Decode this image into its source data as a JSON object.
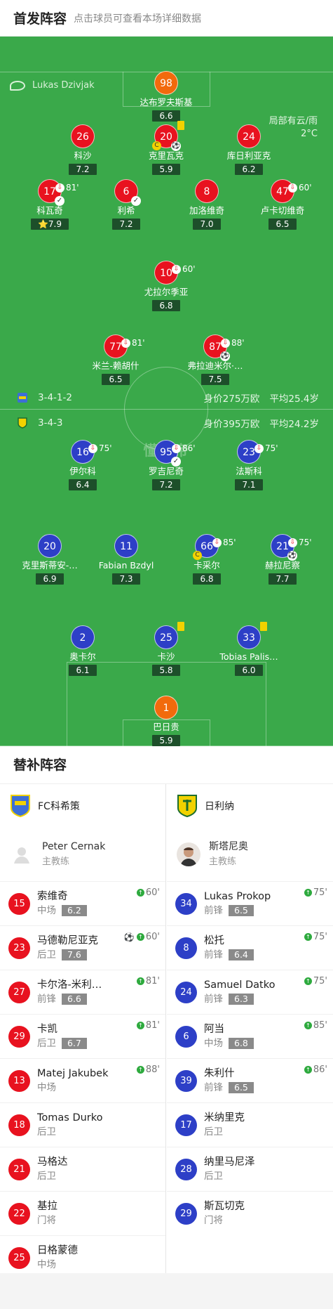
{
  "header": {
    "title": "首发阵容",
    "subtitle": "点击球员可查看本场详细数据"
  },
  "referee": "Lukas Dzivjak",
  "weather": {
    "condition": "局部有云/雨",
    "temp": "2°C"
  },
  "home_formation": {
    "formation": "3-4-1-2",
    "value": "身价275万欧",
    "age": "平均25.4岁"
  },
  "away_formation": {
    "formation": "3-4-3",
    "value": "身价395万欧",
    "age": "平均24.2岁"
  },
  "watermark": "懂球帝",
  "home_players": [
    {
      "num": "98",
      "name": "达布罗夫斯基",
      "rating": "6.6",
      "gk": true
    },
    {
      "num": "26",
      "name": "科沙",
      "rating": "7.2"
    },
    {
      "num": "20",
      "name": "克里瓦克",
      "rating": "5.9",
      "yellow": true,
      "captain": "C",
      "badge": "⚽"
    },
    {
      "num": "24",
      "name": "库日利亚克",
      "rating": "6.2"
    },
    {
      "num": "17",
      "name": "科瓦奇",
      "rating": "⭐7.9",
      "sub": "81'",
      "badge": "✓"
    },
    {
      "num": "6",
      "name": "利希",
      "rating": "7.2",
      "badge": "✓"
    },
    {
      "num": "8",
      "name": "加洛维奇",
      "rating": "7.0"
    },
    {
      "num": "47",
      "name": "卢卡切维奇",
      "rating": "6.5",
      "sub": "60'"
    },
    {
      "num": "10",
      "name": "尤拉尔季亚",
      "rating": "6.8",
      "sub": "60'"
    },
    {
      "num": "77",
      "name": "米兰-赖胡什",
      "rating": "6.5",
      "sub": "81'"
    },
    {
      "num": "87",
      "name": "弗拉迪米尔·…",
      "rating": "7.5",
      "sub": "88'",
      "badge": "⚽"
    }
  ],
  "away_players": [
    {
      "num": "16",
      "name": "伊尔科",
      "rating": "6.4",
      "sub": "75'"
    },
    {
      "num": "95",
      "name": "罗吉尼奇",
      "rating": "7.2",
      "sub": "86'",
      "badge": "✓"
    },
    {
      "num": "23",
      "name": "法斯科",
      "rating": "7.1",
      "sub": "75'"
    },
    {
      "num": "20",
      "name": "克里斯蒂安-…",
      "rating": "6.9"
    },
    {
      "num": "11",
      "name": "Fabian Bzdyl",
      "rating": "7.3"
    },
    {
      "num": "66",
      "name": "卡采尔",
      "rating": "6.8",
      "sub": "85'",
      "captain": "C"
    },
    {
      "num": "21",
      "name": "赫拉尼察",
      "rating": "7.7",
      "sub": "75'",
      "badge": "⚽"
    },
    {
      "num": "2",
      "name": "奥卡尔",
      "rating": "6.1"
    },
    {
      "num": "25",
      "name": "卡沙",
      "rating": "5.8",
      "yellow": true
    },
    {
      "num": "33",
      "name": "Tobias Palis…",
      "rating": "6.0",
      "yellow": true
    },
    {
      "num": "1",
      "name": "巴日贵",
      "rating": "5.9",
      "gk": true
    }
  ],
  "subs_section": {
    "title": "替补阵容"
  },
  "home_team": {
    "name": "FC科希策",
    "coach": {
      "name": "Peter Cernak",
      "role": "主教练"
    },
    "subs": [
      {
        "num": "15",
        "name": "索维奇",
        "pos": "中场",
        "rating": "6.2",
        "min": "60'"
      },
      {
        "num": "23",
        "name": "马德勒尼亚克",
        "pos": "后卫",
        "rating": "7.6",
        "min": "60'",
        "goal": "⚽"
      },
      {
        "num": "27",
        "name": "卡尔洛-米利…",
        "pos": "前锋",
        "rating": "6.6",
        "min": "81'"
      },
      {
        "num": "29",
        "name": "卡凯",
        "pos": "后卫",
        "rating": "6.7",
        "min": "81'"
      },
      {
        "num": "13",
        "name": "Matej Jakubek",
        "pos": "中场",
        "min": "88'"
      },
      {
        "num": "18",
        "name": "Tomas Durko",
        "pos": "后卫"
      },
      {
        "num": "21",
        "name": "马格达",
        "pos": "后卫"
      },
      {
        "num": "22",
        "name": "基拉",
        "pos": "门将"
      },
      {
        "num": "25",
        "name": "日格蒙德",
        "pos": "中场"
      }
    ]
  },
  "away_team": {
    "name": "日利纳",
    "coach": {
      "name": "斯塔尼奥",
      "role": "主教练"
    },
    "subs": [
      {
        "num": "34",
        "name": "Lukas Prokop",
        "pos": "前锋",
        "rating": "6.5",
        "min": "75'"
      },
      {
        "num": "8",
        "name": "松托",
        "pos": "前锋",
        "rating": "6.4",
        "min": "75'"
      },
      {
        "num": "24",
        "name": "Samuel Datko",
        "pos": "前锋",
        "rating": "6.3",
        "min": "75'"
      },
      {
        "num": "6",
        "name": "阿当",
        "pos": "中场",
        "rating": "6.8",
        "min": "85'"
      },
      {
        "num": "39",
        "name": "朱利什",
        "pos": "前锋",
        "rating": "6.5",
        "min": "86'"
      },
      {
        "num": "17",
        "name": "米纳里克",
        "pos": "后卫"
      },
      {
        "num": "28",
        "name": "纳里马尼泽",
        "pos": "后卫"
      },
      {
        "num": "29",
        "name": "斯瓦切克",
        "pos": "门将"
      }
    ]
  }
}
